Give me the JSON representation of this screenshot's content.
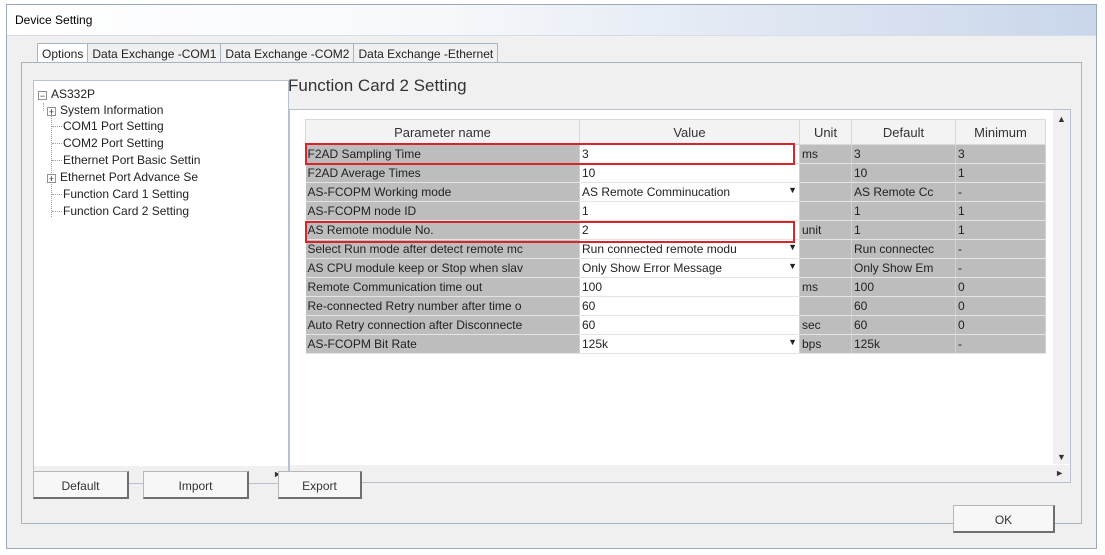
{
  "window": {
    "title": "Device Setting"
  },
  "tabs": [
    "Options",
    "Data Exchange -COM1",
    "Data Exchange -COM2",
    "Data Exchange -Ethernet"
  ],
  "tree": {
    "root": "AS332P",
    "items": [
      {
        "label": "System Information",
        "expandable": true
      },
      {
        "label": "COM1 Port Setting",
        "expandable": false
      },
      {
        "label": "COM2 Port Setting",
        "expandable": false
      },
      {
        "label": "Ethernet Port Basic Settin",
        "expandable": false
      },
      {
        "label": "Ethernet Port Advance Se",
        "expandable": true
      },
      {
        "label": "Function Card 1 Setting",
        "expandable": false
      },
      {
        "label": "Function Card 2 Setting",
        "expandable": false
      }
    ]
  },
  "section_title": "Function Card 2 Setting",
  "grid": {
    "headers": [
      "Parameter name",
      "Value",
      "Unit",
      "Default",
      "Minimum"
    ],
    "rows": [
      {
        "name": "F2AD Sampling Time",
        "value": "3",
        "dropdown": false,
        "unit": "ms",
        "default": "3",
        "minimum": "3"
      },
      {
        "name": "F2AD Average Times",
        "value": "10",
        "dropdown": false,
        "unit": "",
        "default": "10",
        "minimum": "1"
      },
      {
        "name": "AS-FCOPM Working mode",
        "value": "AS Remote Comminucation",
        "dropdown": true,
        "unit": "",
        "default": "AS Remote Cc",
        "minimum": "-"
      },
      {
        "name": "AS-FCOPM node ID",
        "value": "1",
        "dropdown": false,
        "unit": "",
        "default": "1",
        "minimum": "1"
      },
      {
        "name": "AS Remote module No.",
        "value": "2",
        "dropdown": false,
        "unit": "unit",
        "default": "1",
        "minimum": "1"
      },
      {
        "name": "Select Run mode after detect remote mc",
        "value": "Run connected remote modu",
        "dropdown": true,
        "unit": "",
        "default": "Run connectec",
        "minimum": "-"
      },
      {
        "name": "AS CPU module keep or Stop when slav",
        "value": "Only Show Error Message",
        "dropdown": true,
        "unit": "",
        "default": "Only Show Em",
        "minimum": "-"
      },
      {
        "name": "Remote Communication time out",
        "value": "100",
        "dropdown": false,
        "unit": "ms",
        "default": "100",
        "minimum": "0"
      },
      {
        "name": "Re-connected Retry number after time o",
        "value": "60",
        "dropdown": false,
        "unit": "",
        "default": "60",
        "minimum": "0"
      },
      {
        "name": "Auto Retry connection after Disconnecte",
        "value": "60",
        "dropdown": false,
        "unit": "sec",
        "default": "60",
        "minimum": "0"
      },
      {
        "name": "AS-FCOPM Bit Rate",
        "value": "125k",
        "dropdown": true,
        "unit": "bps",
        "default": "125k",
        "minimum": "-"
      }
    ]
  },
  "buttons": {
    "default": "Default",
    "import": "Import",
    "export": "Export",
    "ok": "OK"
  },
  "icons": {
    "dropdown": "▼",
    "scroll_left": "◄",
    "scroll_right": "►",
    "scroll_up": "▲",
    "scroll_down": "▼"
  },
  "colors": {
    "highlight": "#d7262b",
    "readonly_cell": "#bdbdbd"
  }
}
